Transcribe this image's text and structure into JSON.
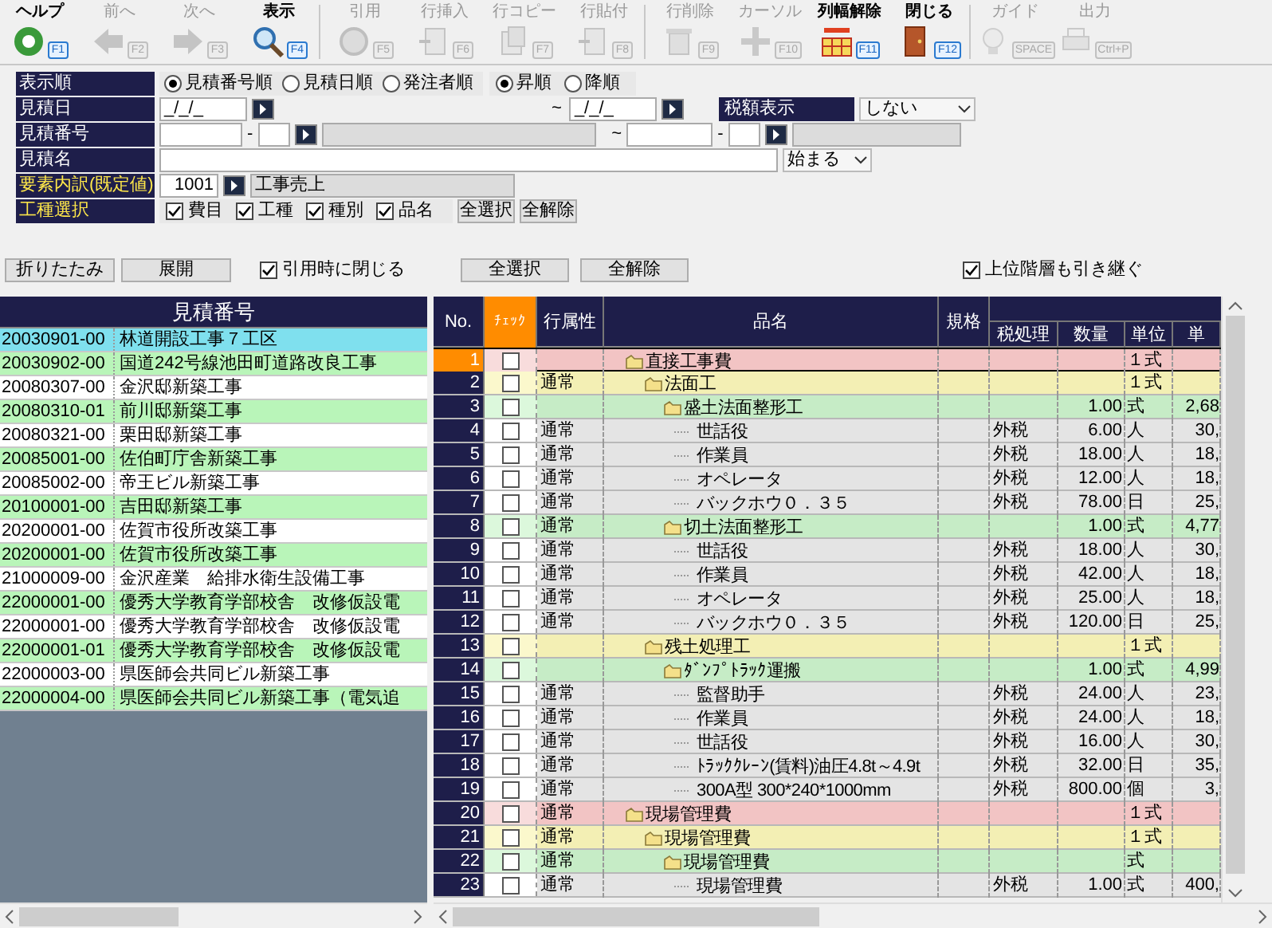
{
  "toolbar": [
    [
      {
        "label": "ヘルプ",
        "key": "F1",
        "disabled": false
      },
      {
        "label": "前へ",
        "key": "F2",
        "disabled": true
      },
      {
        "label": "次へ",
        "key": "F3",
        "disabled": true
      },
      {
        "label": "表示",
        "key": "F4",
        "disabled": false
      }
    ],
    [
      {
        "label": "引用",
        "key": "F5",
        "disabled": true
      },
      {
        "label": "行挿入",
        "key": "F6",
        "disabled": true
      },
      {
        "label": "行コピー",
        "key": "F7",
        "disabled": true
      },
      {
        "label": "行貼付",
        "key": "F8",
        "disabled": true
      }
    ],
    [
      {
        "label": "行削除",
        "key": "F9",
        "disabled": true
      },
      {
        "label": "カーソル",
        "key": "F10",
        "disabled": true
      },
      {
        "label": "列幅解除",
        "key": "F11",
        "disabled": false
      },
      {
        "label": "閉じる",
        "key": "F12",
        "disabled": false
      }
    ],
    [
      {
        "label": "ガイド",
        "key": "SPACE",
        "disabled": true
      },
      {
        "label": "出力",
        "key": "Ctrl+P",
        "disabled": true
      }
    ]
  ],
  "form": {
    "sort_order": {
      "label": "表示順",
      "keys": [
        {
          "label": "見積番号順",
          "selected": true
        },
        {
          "label": "見積日順",
          "selected": false
        },
        {
          "label": "発注者順",
          "selected": false
        }
      ],
      "directions": [
        {
          "label": "昇順",
          "selected": true
        },
        {
          "label": "降順",
          "selected": false
        }
      ]
    },
    "date": {
      "label": "見積日",
      "from": "_/_/_",
      "separator": "~",
      "to": "_/_/_",
      "tax_label": "税額表示",
      "tax_value": "しない"
    },
    "number": {
      "label": "見積番号",
      "from_dash": "-",
      "separator": "~",
      "to_dash": "-"
    },
    "name": {
      "label": "見積名",
      "match": "始まる"
    },
    "element": {
      "label": "要素内訳(既定値)",
      "code": "1001",
      "value": "工事売上"
    },
    "work_types": {
      "label": "工種選択",
      "options": [
        {
          "label": "費目",
          "checked": true
        },
        {
          "label": "工種",
          "checked": true
        },
        {
          "label": "種別",
          "checked": true
        },
        {
          "label": "品名",
          "checked": true
        }
      ],
      "buttons": [
        "全選択",
        "全解除"
      ]
    }
  },
  "actions": {
    "left_buttons": [
      "折りたたみ",
      "展開"
    ],
    "close_on_quote": {
      "label": "引用時に閉じる",
      "checked": true
    },
    "buttons": [
      "全選択",
      "全解除"
    ],
    "inherit_upper": {
      "label": "上位階層も引き継ぐ",
      "checked": true
    }
  },
  "estimate_list": {
    "header": "見積番号",
    "rows": [
      {
        "code": "20030901-00",
        "name": "林道開設工事７工区",
        "selected": true
      },
      {
        "code": "20030902-00",
        "name": "国道242号線池田町道路改良工事",
        "selected": false
      },
      {
        "code": "20080307-00",
        "name": "金沢邸新築工事",
        "selected": false
      },
      {
        "code": "20080310-01",
        "name": "前川邸新築工事",
        "selected": false
      },
      {
        "code": "20080321-00",
        "name": "栗田邸新築工事",
        "selected": false
      },
      {
        "code": "20085001-00",
        "name": "佐伯町庁舎新築工事",
        "selected": false
      },
      {
        "code": "20085002-00",
        "name": "帝王ビル新築工事",
        "selected": false
      },
      {
        "code": "20100001-00",
        "name": "吉田邸新築工事",
        "selected": false
      },
      {
        "code": "20200001-00",
        "name": "佐賀市役所改築工事",
        "selected": false
      },
      {
        "code": "20200001-00",
        "name": "佐賀市役所改築工事",
        "selected": false
      },
      {
        "code": "21000009-00",
        "name": "金沢産業　給排水衛生設備工事",
        "selected": false
      },
      {
        "code": "22000001-00",
        "name": "優秀大学教育学部校舎　改修仮設電",
        "selected": false
      },
      {
        "code": "22000001-00",
        "name": "優秀大学教育学部校舎　改修仮設電",
        "selected": false
      },
      {
        "code": "22000001-01",
        "name": "優秀大学教育学部校舎　改修仮設電",
        "selected": false
      },
      {
        "code": "22000003-00",
        "name": "県医師会共同ビル新築工事",
        "selected": false
      },
      {
        "code": "22000004-00",
        "name": "県医師会共同ビル新築工事（電気追",
        "selected": false
      }
    ]
  },
  "detail_table": {
    "columns": [
      "No.",
      "ﾁｪｯｸ",
      "行属性",
      "品名",
      "規格",
      "税処理",
      "数量",
      "単位",
      "単"
    ],
    "rows": [
      {
        "no": "1",
        "name": "直接工事費",
        "unit": "１式",
        "checked": false,
        "selected": true,
        "children": [
          {
            "no": "2",
            "attr": "通常",
            "name": "法面工",
            "unit": "１式",
            "checked": false,
            "selected": false,
            "children": [
              {
                "no": "3",
                "name": "盛土法面整形工",
                "qty": "1.00",
                "unit": "式",
                "price": "2,68",
                "checked": false,
                "selected": false,
                "children": [
                  {
                    "no": "4",
                    "attr": "通常",
                    "name": "世話役",
                    "tax": "外税",
                    "qty": "6.00",
                    "unit": "人",
                    "price": "30,",
                    "checked": false,
                    "selected": false
                  },
                  {
                    "no": "5",
                    "attr": "通常",
                    "name": "作業員",
                    "tax": "外税",
                    "qty": "18.00",
                    "unit": "人",
                    "price": "18,",
                    "checked": false,
                    "selected": false
                  },
                  {
                    "no": "6",
                    "attr": "通常",
                    "name": "オペレータ",
                    "tax": "外税",
                    "qty": "12.00",
                    "unit": "人",
                    "price": "18,",
                    "checked": false,
                    "selected": false
                  },
                  {
                    "no": "7",
                    "attr": "通常",
                    "name": "バックホウ０．３５",
                    "tax": "外税",
                    "qty": "78.00",
                    "unit": "日",
                    "price": "25,",
                    "checked": false,
                    "selected": false
                  }
                ]
              },
              {
                "no": "8",
                "attr": "通常",
                "name": "切土法面整形工",
                "qty": "1.00",
                "unit": "式",
                "price": "4,77",
                "checked": false,
                "selected": false,
                "children": [
                  {
                    "no": "9",
                    "attr": "通常",
                    "name": "世話役",
                    "tax": "外税",
                    "qty": "18.00",
                    "unit": "人",
                    "price": "30,",
                    "checked": false,
                    "selected": false
                  },
                  {
                    "no": "10",
                    "attr": "通常",
                    "name": "作業員",
                    "tax": "外税",
                    "qty": "42.00",
                    "unit": "人",
                    "price": "18,",
                    "checked": false,
                    "selected": false
                  },
                  {
                    "no": "11",
                    "attr": "通常",
                    "name": "オペレータ",
                    "tax": "外税",
                    "qty": "25.00",
                    "unit": "人",
                    "price": "18,",
                    "checked": false,
                    "selected": false
                  },
                  {
                    "no": "12",
                    "attr": "通常",
                    "name": "バックホウ０．３５",
                    "tax": "外税",
                    "qty": "120.00",
                    "unit": "日",
                    "price": "25,",
                    "checked": false,
                    "selected": false
                  }
                ]
              }
            ]
          },
          {
            "no": "13",
            "name": "残土処理工",
            "unit": "１式",
            "checked": false,
            "selected": false,
            "children": [
              {
                "no": "14",
                "name": "ﾀﾞﾝﾌﾟﾄﾗｯｸ運搬",
                "qty": "1.00",
                "unit": "式",
                "price": "4,99",
                "checked": false,
                "selected": false,
                "children": [
                  {
                    "no": "15",
                    "attr": "通常",
                    "name": "監督助手",
                    "tax": "外税",
                    "qty": "24.00",
                    "unit": "人",
                    "price": "23,",
                    "checked": false,
                    "selected": false
                  },
                  {
                    "no": "16",
                    "attr": "通常",
                    "name": "作業員",
                    "tax": "外税",
                    "qty": "24.00",
                    "unit": "人",
                    "price": "18,",
                    "checked": false,
                    "selected": false
                  },
                  {
                    "no": "17",
                    "attr": "通常",
                    "name": "世話役",
                    "tax": "外税",
                    "qty": "16.00",
                    "unit": "人",
                    "price": "30,",
                    "checked": false,
                    "selected": false
                  },
                  {
                    "no": "18",
                    "attr": "通常",
                    "name": "ﾄﾗｯｸｸﾚｰﾝ(賃料)油圧4.8t～4.9t",
                    "tax": "外税",
                    "qty": "32.00",
                    "unit": "日",
                    "price": "35,",
                    "checked": false,
                    "selected": false
                  },
                  {
                    "no": "19",
                    "attr": "通常",
                    "name": "300A型 300*240*1000mm",
                    "tax": "外税",
                    "qty": "800.00",
                    "unit": "個",
                    "price": "3,",
                    "checked": false,
                    "selected": false
                  }
                ]
              }
            ]
          }
        ]
      },
      {
        "no": "20",
        "attr": "通常",
        "name": "現場管理費",
        "unit": "１式",
        "checked": false,
        "selected": false,
        "children": [
          {
            "no": "21",
            "attr": "通常",
            "name": "現場管理費",
            "unit": "１式",
            "checked": false,
            "selected": false,
            "children": [
              {
                "no": "22",
                "attr": "通常",
                "name": "現場管理費",
                "unit": "式",
                "checked": false,
                "selected": false,
                "children": [
                  {
                    "no": "23",
                    "attr": "通常",
                    "name": "現場管理費",
                    "tax": "外税",
                    "qty": "1.00",
                    "unit": "式",
                    "price": "400,",
                    "checked": false,
                    "selected": false
                  }
                ]
              }
            ]
          }
        ]
      }
    ]
  }
}
